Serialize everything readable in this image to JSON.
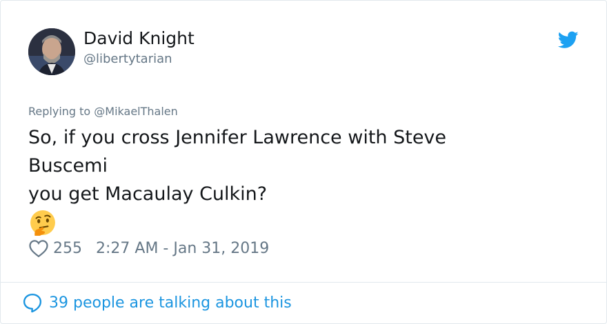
{
  "user": {
    "name": "David Knight",
    "handle": "@libertytarian"
  },
  "reply": {
    "prefix": "Replying to",
    "mention": "@MikaelThalen"
  },
  "tweet": {
    "lines": [
      "So, if you cross Jennifer Lawrence with Steve",
      "Buscemi",
      "you get Macaulay Culkin?"
    ],
    "emoji": "thinking-face-emoji"
  },
  "meta": {
    "likes": "255",
    "timestamp": "2:27 AM - Jan 31, 2019"
  },
  "footer": {
    "talking": "39 people are talking about this"
  },
  "colors": {
    "twitter_blue": "#1da1f2",
    "link_blue": "#1b95e0",
    "secondary_text": "#657786",
    "border": "#e1e8ed"
  }
}
